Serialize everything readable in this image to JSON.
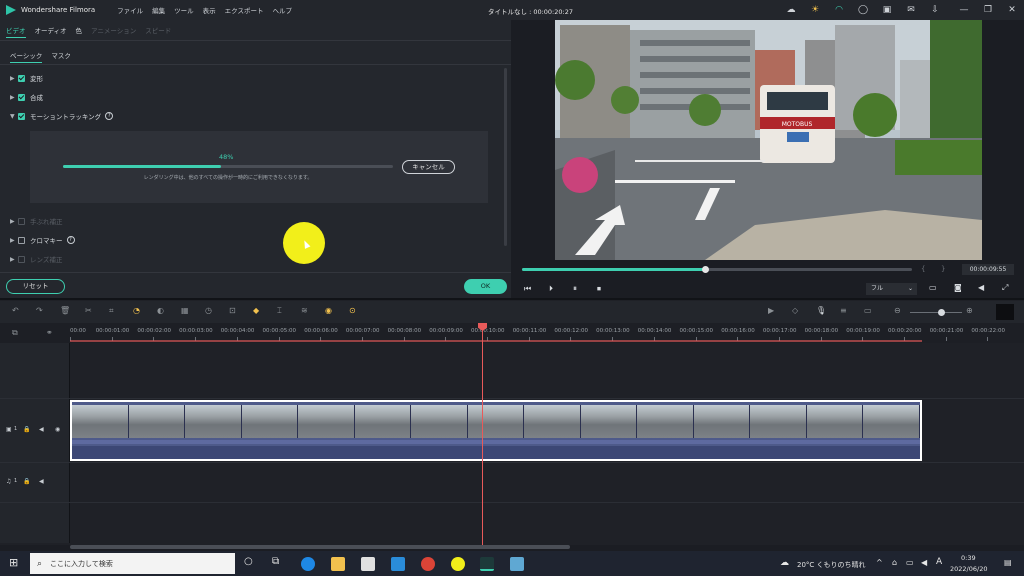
{
  "app": {
    "name": "Wondershare Filmora",
    "menu": [
      "ファイル",
      "編集",
      "ツール",
      "表示",
      "エクスポート",
      "ヘルプ"
    ],
    "document_title": "タイトルなし : 00:00:20:27"
  },
  "left_panel": {
    "tabs": [
      {
        "label": "ビデオ",
        "state": "active"
      },
      {
        "label": "オーディオ",
        "state": "normal"
      },
      {
        "label": "色",
        "state": "normal"
      },
      {
        "label": "アニメーション",
        "state": "disabled"
      },
      {
        "label": "スピード",
        "state": "disabled"
      }
    ],
    "subtabs": [
      {
        "label": "ベーシック",
        "active": true
      },
      {
        "label": "マスク",
        "active": false
      }
    ],
    "sections": [
      {
        "label": "変形",
        "checked": true
      },
      {
        "label": "合成",
        "checked": true
      },
      {
        "label": "モーショントラッキング",
        "checked": true,
        "expanded": true
      },
      {
        "label": "手ぶれ補正",
        "disabled": true
      },
      {
        "label": "クロマキー",
        "checked": false
      },
      {
        "label": "レンズ補正",
        "disabled": true
      }
    ],
    "tracking": {
      "progress_percent": 48,
      "progress_label": "48%",
      "message": "レンダリング中は、他のすべての操作が一時的にご利用できなくなります。",
      "cancel_label": "キャンセル"
    },
    "reset_label": "リセット",
    "ok_label": "OK"
  },
  "preview": {
    "bus_sign": "MOTOBUS",
    "playhead_fraction": 0.47,
    "timecode": "00:00:09:55",
    "quality": "フル"
  },
  "timeline": {
    "ruler": [
      "00:00",
      "00:00:01:00",
      "00:00:02:00",
      "00:00:03:00",
      "00:00:04:00",
      "00:00:05:00",
      "00:00:06:00",
      "00:00:07:00",
      "00:00:08:00",
      "00:00:09:00",
      "00:00:10:00",
      "00:00:11:00",
      "00:00:12:00",
      "00:00:13:00",
      "00:00:14:00",
      "00:00:15:00",
      "00:00:16:00",
      "00:00:17:00",
      "00:00:18:00",
      "00:00:19:00",
      "00:00:20:00",
      "00:00:21:00",
      "00:00:22:00"
    ],
    "video_track_label": "1",
    "audio_track_label": "1"
  },
  "taskbar": {
    "search_placeholder": "ここに入力して検索",
    "weather": "20°C くもりのち晴れ",
    "ime": "A",
    "time": "0:39",
    "date": "2022/06/20"
  },
  "colors": {
    "accent": "#3ecfb0",
    "playhead": "#e85a5a",
    "cursor_highlight": "#f2ef1a",
    "clip_border": "#ffffff"
  }
}
